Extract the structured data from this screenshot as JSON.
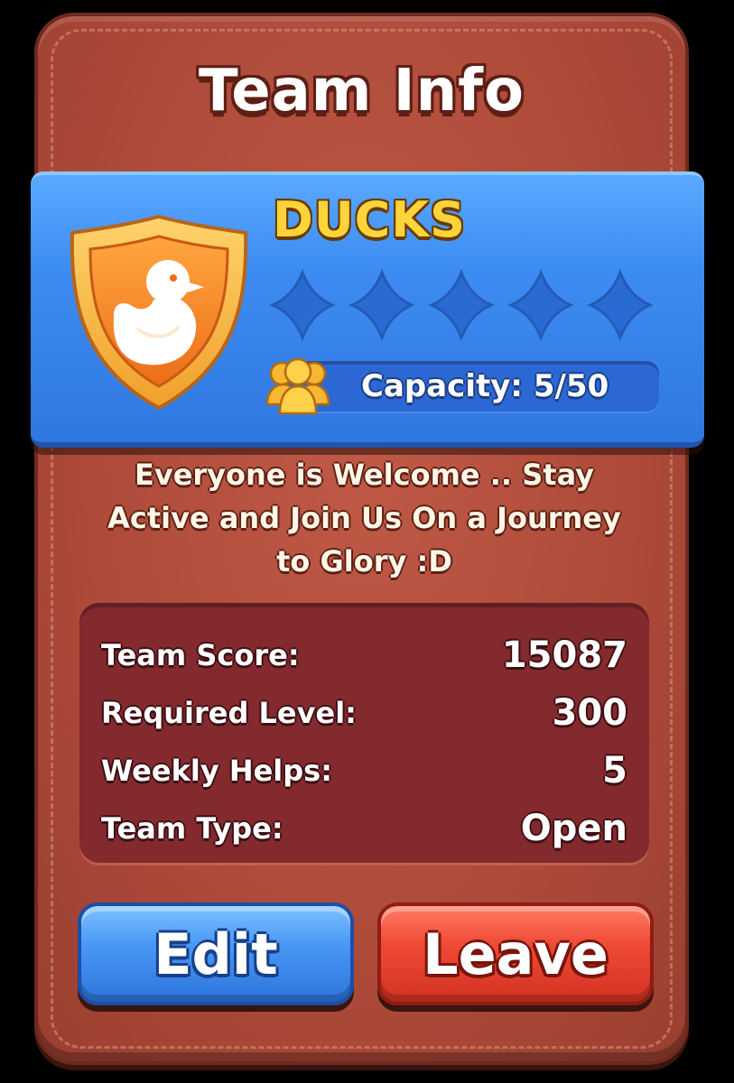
{
  "dialog": {
    "title": "Team Info"
  },
  "team": {
    "name": "DUCKS",
    "badge_icon": "duck-shield-icon",
    "stars_filled": 0,
    "stars_total": 5,
    "capacity_label": "Capacity: 5/50",
    "capacity_icon": "members-icon",
    "description": "Everyone is Welcome .. Stay Active and Join Us On a Journey to Glory :D"
  },
  "stats": [
    {
      "label": "Team Score:",
      "value": "15087"
    },
    {
      "label": "Required Level:",
      "value": "300"
    },
    {
      "label": "Weekly Helps:",
      "value": "5"
    },
    {
      "label": "Team Type:",
      "value": "Open"
    }
  ],
  "buttons": {
    "edit_label": "Edit",
    "leave_label": "Leave"
  },
  "colors": {
    "panel": "#ad4a39",
    "ribbon": "#3d8cf2",
    "team_name": "#ffd43a",
    "stats_box": "#832a2f",
    "edit_button": "#4a98f5",
    "leave_button": "#ef4a36"
  }
}
